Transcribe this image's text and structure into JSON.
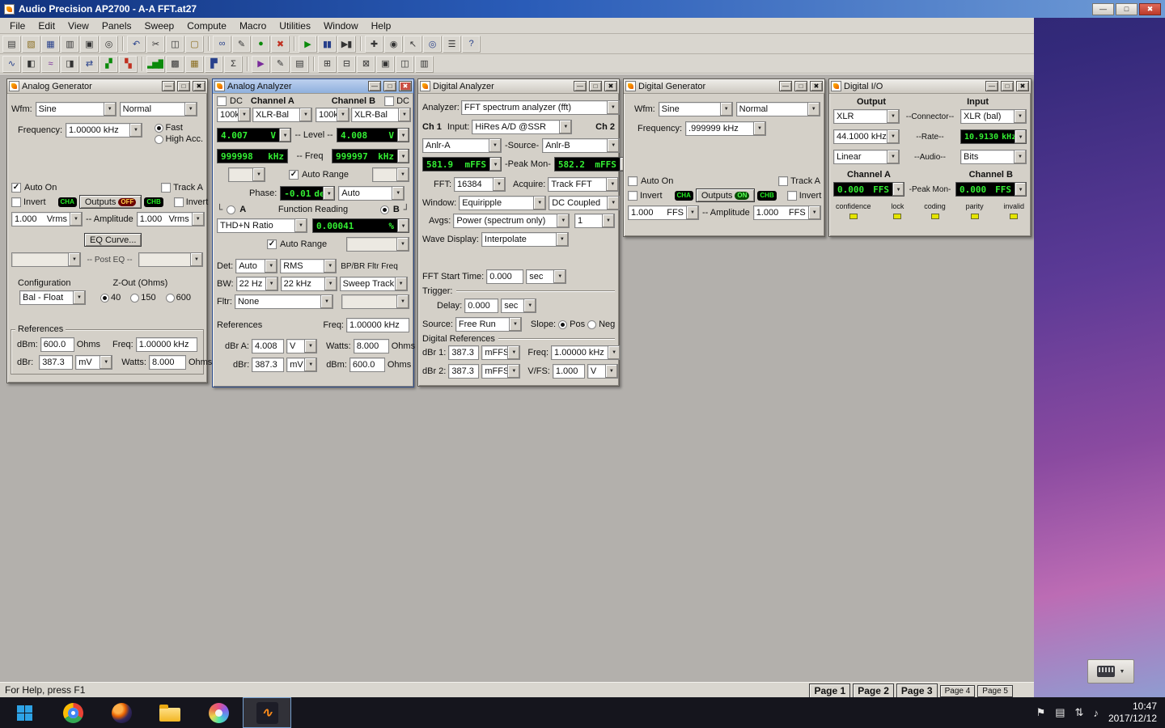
{
  "window": {
    "title": "Audio Precision AP2700 - A-A FFT.at27",
    "controls": [
      {
        "name": "minimize-button",
        "glyph": "—"
      },
      {
        "name": "maximize-button",
        "glyph": "□"
      },
      {
        "name": "close-button",
        "glyph": "✖"
      }
    ]
  },
  "panel_controls": {
    "minimize": "—",
    "maximize": "□",
    "close": "✖"
  },
  "menu": [
    "File",
    "Edit",
    "View",
    "Panels",
    "Sweep",
    "Compute",
    "Macro",
    "Utilities",
    "Window",
    "Help"
  ],
  "toolbar_row1": [
    {
      "name": "new-test-icon",
      "glyph": "▤",
      "color": "#333333"
    },
    {
      "name": "open-test-icon",
      "glyph": "▧",
      "color": "#8a6d1f"
    },
    {
      "name": "save-test-icon",
      "glyph": "▦",
      "color": "#27408b"
    },
    {
      "name": "save-data-icon",
      "glyph": "▥",
      "color": "#333333"
    },
    {
      "name": "print-icon",
      "glyph": "▣",
      "color": "#333333"
    },
    {
      "name": "print-preview-icon",
      "glyph": "◎",
      "color": "#333333"
    },
    {
      "sep": true
    },
    {
      "name": "undo-icon",
      "glyph": "↶",
      "color": "#27408b"
    },
    {
      "name": "cut-icon",
      "glyph": "✂",
      "color": "#333333"
    },
    {
      "name": "copy-icon",
      "glyph": "◫",
      "color": "#333333"
    },
    {
      "name": "paste-icon",
      "glyph": "▢",
      "color": "#8a6d1f"
    },
    {
      "sep": true
    },
    {
      "name": "learn-macro-icon",
      "glyph": "∞",
      "color": "#27408b"
    },
    {
      "name": "edit-macro-icon",
      "glyph": "✎",
      "color": "#333333"
    },
    {
      "name": "run-macro-icon",
      "glyph": "●",
      "color": "#0a8a0a"
    },
    {
      "name": "abort-macro-icon",
      "glyph": "✖",
      "color": "#c03020"
    },
    {
      "sep": true
    },
    {
      "name": "run-sweep-icon",
      "glyph": "▶",
      "color": "#0a8a0a"
    },
    {
      "name": "pause-sweep-icon",
      "glyph": "▮▮",
      "color": "#27408b"
    },
    {
      "name": "rerun-sweep-icon",
      "glyph": "▶▮",
      "color": "#333333"
    },
    {
      "sep": true
    },
    {
      "name": "pan-tool-icon",
      "glyph": "✚",
      "color": "#333333"
    },
    {
      "name": "monitor-icon",
      "glyph": "◉",
      "color": "#333333"
    },
    {
      "name": "cursor-tool-icon",
      "glyph": "↖",
      "color": "#333333"
    },
    {
      "name": "zoom-tool-icon",
      "glyph": "◎",
      "color": "#27408b"
    },
    {
      "name": "settings-icon",
      "glyph": "☰",
      "color": "#333333"
    },
    {
      "name": "help-icon",
      "glyph": "?",
      "color": "#27408b"
    }
  ],
  "toolbar_row2": [
    {
      "name": "panel-analog-generator-icon",
      "glyph": "∿",
      "color": "#27408b"
    },
    {
      "name": "panel-analog-analyzer-icon",
      "glyph": "◧",
      "color": "#333333"
    },
    {
      "name": "panel-digital-generator-icon",
      "glyph": "≈",
      "color": "#7a2b9b"
    },
    {
      "name": "panel-digital-analyzer-icon",
      "glyph": "◨",
      "color": "#333333"
    },
    {
      "name": "panel-digital-io-icon",
      "glyph": "⇄",
      "color": "#27408b"
    },
    {
      "name": "panel-sweep-icon",
      "glyph": "▞",
      "color": "#0a8a0a"
    },
    {
      "name": "panel-settling-icon",
      "glyph": "▚",
      "color": "#c03020"
    },
    {
      "sep": true
    },
    {
      "name": "panel-bargraph-icon",
      "glyph": "▂▅▇",
      "color": "#0a8a0a"
    },
    {
      "name": "panel-status-bits-icon",
      "glyph": "▩",
      "color": "#333333"
    },
    {
      "name": "panel-data-editor-icon",
      "glyph": "▦",
      "color": "#8a6d1f"
    },
    {
      "name": "panel-graph-icon",
      "glyph": "▛",
      "color": "#27408b"
    },
    {
      "name": "panel-regulation-icon",
      "glyph": "Σ",
      "color": "#333333"
    },
    {
      "sep": true
    },
    {
      "name": "run-macro-2-icon",
      "glyph": "▶",
      "color": "#7a2b9b"
    },
    {
      "name": "edit-2-icon",
      "glyph": "✎",
      "color": "#333333"
    },
    {
      "name": "log-icon",
      "glyph": "▤",
      "color": "#333333"
    },
    {
      "sep": true
    },
    {
      "name": "view-grid-1-icon",
      "glyph": "⊞",
      "color": "#333333"
    },
    {
      "name": "view-grid-2-icon",
      "glyph": "⊟",
      "color": "#333333"
    },
    {
      "name": "view-grid-3-icon",
      "glyph": "⊠",
      "color": "#333333"
    },
    {
      "name": "view-grid-4-icon",
      "glyph": "▣",
      "color": "#333333"
    },
    {
      "name": "view-grid-5-icon",
      "glyph": "◫",
      "color": "#333333"
    },
    {
      "name": "view-grid-6-icon",
      "glyph": "▥",
      "color": "#333333"
    }
  ],
  "panels": {
    "analog_generator": {
      "title": "Analog Generator",
      "wfm_label": "Wfm:",
      "wfm": "Sine",
      "wfm_mode": "Normal",
      "frequency_label": "Frequency:",
      "frequency": "1.00000 kHz",
      "fast_label": "Fast",
      "fast_selected": true,
      "high_acc_label": "High Acc.",
      "high_acc_selected": false,
      "auto_on_label": "Auto On",
      "auto_on_checked": true,
      "track_a_label": "Track A",
      "track_a_checked": false,
      "invert_label": "Invert",
      "invert_a_checked": false,
      "invert_b_checked": false,
      "cha": "CHA",
      "chb": "CHB",
      "outputs_label": "Outputs",
      "outputs_state": "OFF",
      "amp_a_value": "1.000",
      "amp_a_unit": "Vrms",
      "amplitude_label": "-- Amplitude",
      "amp_b_value": "1.000",
      "amp_b_unit": "Vrms",
      "eq_curve_label": "EQ Curve...",
      "post_eq_label": "-- Post EQ --",
      "configuration_label": "Configuration",
      "zout_label": "Z-Out (Ohms)",
      "config_value": "Bal - Float",
      "zout_40": "40",
      "zout_40_selected": true,
      "zout_150": "150",
      "zout_600": "600",
      "references_label": "References",
      "dbm_label": "dBm:",
      "dbm_value": "600.0",
      "dbm_unit": "Ohms",
      "freq_ref_label": "Freq:",
      "freq_ref_value": "1.00000 kHz",
      "dbr_label": "dBr:",
      "dbr_value": "387.3",
      "dbr_unit": "mV",
      "watts_label": "Watts:",
      "watts_value": "8.000",
      "watts_unit": "Ohms"
    },
    "analog_analyzer": {
      "title": "Analog Analyzer",
      "dc_label": "DC",
      "dc_a_checked": false,
      "dc_b_checked": false,
      "channel_a_label": "Channel A",
      "channel_b_label": "Channel B",
      "imp_a": "100k",
      "conn_a": "XLR-Bal",
      "imp_b": "100k",
      "conn_b": "XLR-Bal",
      "level_a_value": "4.007",
      "level_a_unit": "V",
      "level_label": "-- Level --",
      "level_b_value": "4.008",
      "level_b_unit": "V",
      "freq_a_value": "999998",
      "freq_a_unit": "kHz",
      "freq_label": "-- Freq",
      "freq_b_value": "999997",
      "freq_b_unit": "kHz",
      "auto_range_label": "Auto Range",
      "auto_range_1_checked": true,
      "auto_range_2_checked": true,
      "phase_label": "Phase:",
      "phase_value": "-0.01",
      "phase_unit": "deg",
      "phase_mode": "Auto",
      "func_a_label": "A",
      "func_a_selected": false,
      "func_label": "Function Reading",
      "func_b_label": "B",
      "func_b_selected": true,
      "function_value": "THD+N Ratio",
      "reading_value": "0.00041",
      "reading_unit": "%",
      "det_label": "Det:",
      "det_value": "Auto",
      "det_mode": "RMS",
      "bpbr_label": "BP/BR Fltr Freq",
      "bw_label": "BW:",
      "bw_low": "22 Hz",
      "bw_high": "22 kHz",
      "bw_track": "Sweep Track",
      "fltr_label": "Fltr:",
      "fltr_value": "None",
      "references_label": "References",
      "freq_ref_label": "Freq:",
      "freq_ref_value": "1.00000 kHz",
      "dbra_label": "dBr A:",
      "dbra_value": "4.008",
      "dbra_unit": "V",
      "watts_label": "Watts:",
      "watts_value": "8.000",
      "watts_unit": "Ohms",
      "dbr_label": "dBr:",
      "dbr_value": "387.3",
      "dbr_unit": "mV",
      "dbm_label": "dBm:",
      "dbm_value": "600.0",
      "dbm_unit": "Ohms"
    },
    "digital_analyzer": {
      "title": "Digital Analyzer",
      "analyzer_label": "Analyzer:",
      "analyzer": "FFT spectrum analyzer (fft)",
      "ch1_label": "Ch 1",
      "input_label": "Input:",
      "input": "HiRes A/D @SSR",
      "ch2_label": "Ch 2",
      "source_a": "Anlr-A",
      "source_label": "-Source-",
      "source_b": "Anlr-B",
      "peak_a_value": "581.9",
      "peak_a_unit": "mFFS",
      "peak_label": "-Peak Mon-",
      "peak_b_value": "582.2",
      "peak_b_unit": "mFFS",
      "fft_label": "FFT:",
      "fft_size": "16384",
      "acquire_label": "Acquire:",
      "acquire": "Track FFT",
      "window_label": "Window:",
      "window": "Equiripple",
      "coupling": "DC Coupled",
      "avgs_label": "Avgs:",
      "avgs_mode": "Power (spectrum only)",
      "avgs_count": "1",
      "wave_label": "Wave Display:",
      "wave": "Interpolate",
      "fft_start_label": "FFT Start Time:",
      "fft_start_value": "0.000",
      "fft_start_unit": "sec",
      "trigger_label": "Trigger:",
      "delay_label": "Delay:",
      "delay_value": "0.000",
      "delay_unit": "sec",
      "trig_source_label": "Source:",
      "trig_source": "Free Run",
      "slope_label": "Slope:",
      "slope_pos_label": "Pos",
      "slope_pos_selected": true,
      "slope_neg_label": "Neg",
      "slope_neg_selected": false,
      "dig_ref_label": "Digital References",
      "dbr1_label": "dBr 1:",
      "dbr1_value": "387.3",
      "dbr1_unit": "mFFS",
      "ref_freq_label": "Freq:",
      "ref_freq_value": "1.00000 kHz",
      "dbr2_label": "dBr 2:",
      "dbr2_value": "387.3",
      "dbr2_unit": "mFFS",
      "vfs_label": "V/FS:",
      "vfs_value": "1.000",
      "vfs_unit": "V"
    },
    "digital_generator": {
      "title": "Digital Generator",
      "wfm_label": "Wfm:",
      "wfm": "Sine",
      "wfm_mode": "Normal",
      "frequency_label": "Frequency:",
      "frequency": ".999999 kHz",
      "auto_on_label": "Auto On",
      "auto_on_checked": false,
      "track_a_label": "Track A",
      "track_a_checked": false,
      "invert_label": "Invert",
      "invert_a_checked": false,
      "invert_b_checked": false,
      "cha": "CHA",
      "chb": "CHB",
      "outputs_label": "Outputs",
      "outputs_state": "ON",
      "amp_a_value": "1.000",
      "amp_a_unit": "FFS",
      "amplitude_label": "-- Amplitude",
      "amp_b_value": "1.000",
      "amp_b_unit": "FFS"
    },
    "digital_io": {
      "title": "Digital I/O",
      "output_label": "Output",
      "input_label": "Input",
      "out_connector": "XLR",
      "connector_label": "--Connector--",
      "in_connector": "XLR (bal)",
      "out_rate": "44.1000 kHz",
      "rate_label": "--Rate--",
      "in_rate_value": "10.9130",
      "in_rate_unit": "kHz",
      "out_audio": "Linear",
      "audio_label": "--Audio--",
      "in_audio": "Bits",
      "channel_a_label": "Channel A",
      "channel_b_label": "Channel B",
      "peak_a_value": "0.000",
      "peak_a_unit": "FFS",
      "peak_label": "-Peak Mon-",
      "peak_b_value": "0.000",
      "peak_b_unit": "FFS",
      "indicators": [
        "confidence",
        "lock",
        "coding",
        "parity",
        "invalid"
      ]
    }
  },
  "statusbar": {
    "help_text": "For Help, press F1",
    "pages": [
      "Page 1",
      "Page 2",
      "Page 3",
      "Page 4",
      "Page 5"
    ]
  },
  "taskbar": {
    "apps": [
      {
        "name": "start-button"
      },
      {
        "name": "chrome-icon"
      },
      {
        "name": "firefox-icon"
      },
      {
        "name": "explorer-icon"
      },
      {
        "name": "paint-icon"
      },
      {
        "name": "ap2700-icon"
      }
    ],
    "tray": [
      {
        "name": "tray-flag-icon",
        "glyph": "⚑"
      },
      {
        "name": "tray-display-icon",
        "glyph": "▤"
      },
      {
        "name": "tray-network-icon",
        "glyph": "⇅"
      },
      {
        "name": "tray-volume-icon",
        "glyph": "♪"
      }
    ],
    "time": "10:47",
    "date": "2017/12/12"
  }
}
